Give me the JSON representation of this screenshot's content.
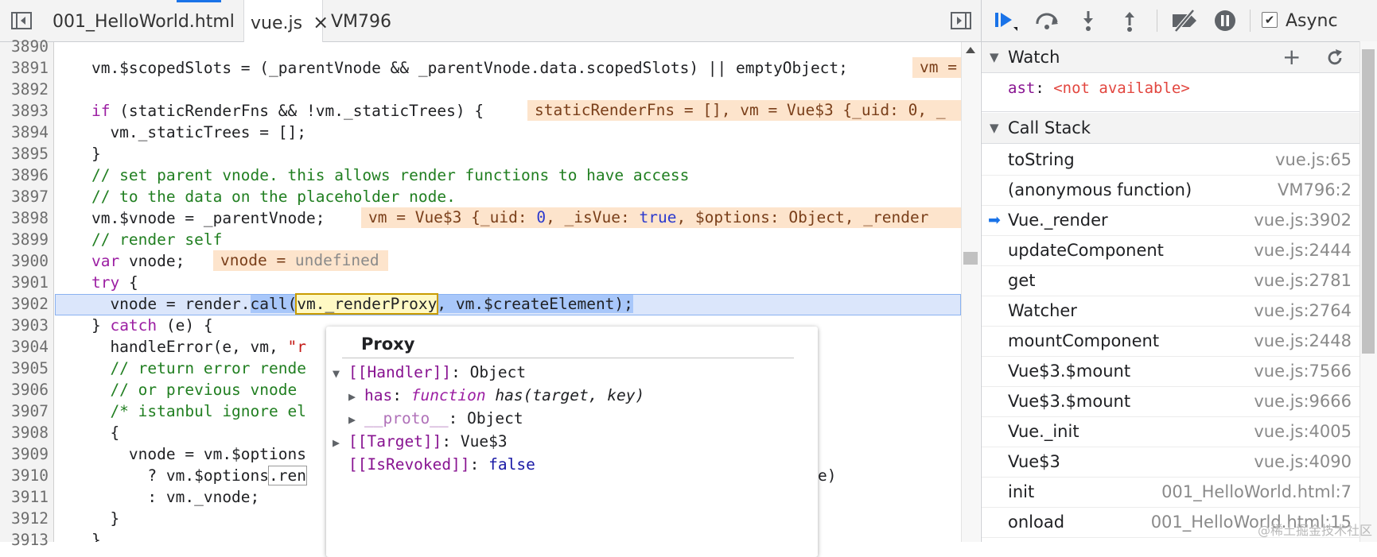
{
  "tabs": {
    "items": [
      {
        "label": "001_HelloWorld.html"
      },
      {
        "label": "vue.js",
        "close": "×"
      },
      {
        "label": "VM796"
      }
    ]
  },
  "editor": {
    "line_numbers": [
      "3890",
      "3891",
      "3892",
      "3893",
      "3894",
      "3895",
      "3896",
      "3897",
      "3898",
      "3899",
      "3900",
      "3901",
      "3902",
      "3903",
      "3904",
      "3905",
      "3906",
      "3907",
      "3908",
      "3909",
      "3910",
      "3911",
      "3912",
      "3913"
    ],
    "lines": {
      "l3891": "    vm.$scopedSlots = (_parentVnode && _parentVnode.data.scopedSlots) || emptyObject;",
      "l3893_kw": "if",
      "l3893_rest": " (staticRenderFns && !vm._staticTrees) {",
      "l3894": "      vm._staticTrees = [];",
      "l3895": "    }",
      "l3896": "    // set parent vnode. this allows render functions to have access",
      "l3897": "    // to the data on the placeholder node.",
      "l3898": "    vm.$vnode = _parentVnode;",
      "l3899": "    // render self",
      "l3900_kw": "var",
      "l3900_rest": " vnode;",
      "l3901_kw": "try",
      "l3901_rest": " {",
      "l3902_a": "      vnode = render.",
      "l3902_call": "call(",
      "l3902_proxy": "vm._renderProxy",
      "l3902_rest": ", vm.$createElement);",
      "l3903_a": "    } ",
      "l3903_kw": "catch",
      "l3903_rest": " (e) {",
      "l3904_a": "      handleError(e, vm, ",
      "l3904_str": "\"r",
      "l3905": "      // return error rende",
      "l3906": "      // or previous vnode",
      "l3907": "      /* istanbul ignore el",
      "l3908": "      {",
      "l3909": "        vnode = vm.$options",
      "l3910_a": "          ? vm.$options",
      "l3910_b": ".ren",
      "l3910_tail": "e)",
      "l3911": "          : vm._vnode;",
      "l3912": "      }",
      "l3913": "    }"
    },
    "inline_values": {
      "v3891": "vm = ",
      "v3893": "staticRenderFns = [], vm = Vue$3 {_uid: 0, _",
      "v3898_a": "vm = Vue$3 {_uid: ",
      "v3898_num": "0",
      "v3898_b": ", _isVue: ",
      "v3898_true": "true",
      "v3898_c": ", $options: Object, _render",
      "v3900_a": "vnode = ",
      "v3900_undef": "undefined"
    }
  },
  "popover": {
    "title": "Proxy",
    "rows": [
      {
        "name": "[[Handler]]",
        "sep": ": ",
        "value": "Object"
      },
      {
        "name": "has",
        "sep": ": ",
        "kw": "function",
        "value": " has(target, key)"
      },
      {
        "name": "__proto__",
        "sep": ": ",
        "value": "Object"
      },
      {
        "name": "[[Target]]",
        "sep": ": ",
        "value": "Vue$3"
      },
      {
        "name": "[[IsRevoked]]",
        "sep": ": ",
        "value": "false"
      }
    ]
  },
  "debugger": {
    "async_label": "Async",
    "watch": {
      "title": "Watch",
      "expr_name": "ast",
      "expr_sep": ": ",
      "expr_value": "<not available>"
    },
    "call_stack": {
      "title": "Call Stack",
      "frames": [
        {
          "fn": "toString",
          "loc": "vue.js:65"
        },
        {
          "fn": "(anonymous function)",
          "loc": "VM796:2"
        },
        {
          "fn": "Vue._render",
          "loc": "vue.js:3902",
          "current": true
        },
        {
          "fn": "updateComponent",
          "loc": "vue.js:2444"
        },
        {
          "fn": "get",
          "loc": "vue.js:2781"
        },
        {
          "fn": "Watcher",
          "loc": "vue.js:2764"
        },
        {
          "fn": "mountComponent",
          "loc": "vue.js:2448"
        },
        {
          "fn": "Vue$3.$mount",
          "loc": "vue.js:7566"
        },
        {
          "fn": "Vue$3.$mount",
          "loc": "vue.js:9666"
        },
        {
          "fn": "Vue._init",
          "loc": "vue.js:4005"
        },
        {
          "fn": "Vue$3",
          "loc": "vue.js:4090"
        },
        {
          "fn": "init",
          "loc": "001_HelloWorld.html:7"
        },
        {
          "fn": "onload",
          "loc": "001_HelloWorld.html:15"
        }
      ]
    }
  },
  "watermark": "@稀土掘金技术社区"
}
